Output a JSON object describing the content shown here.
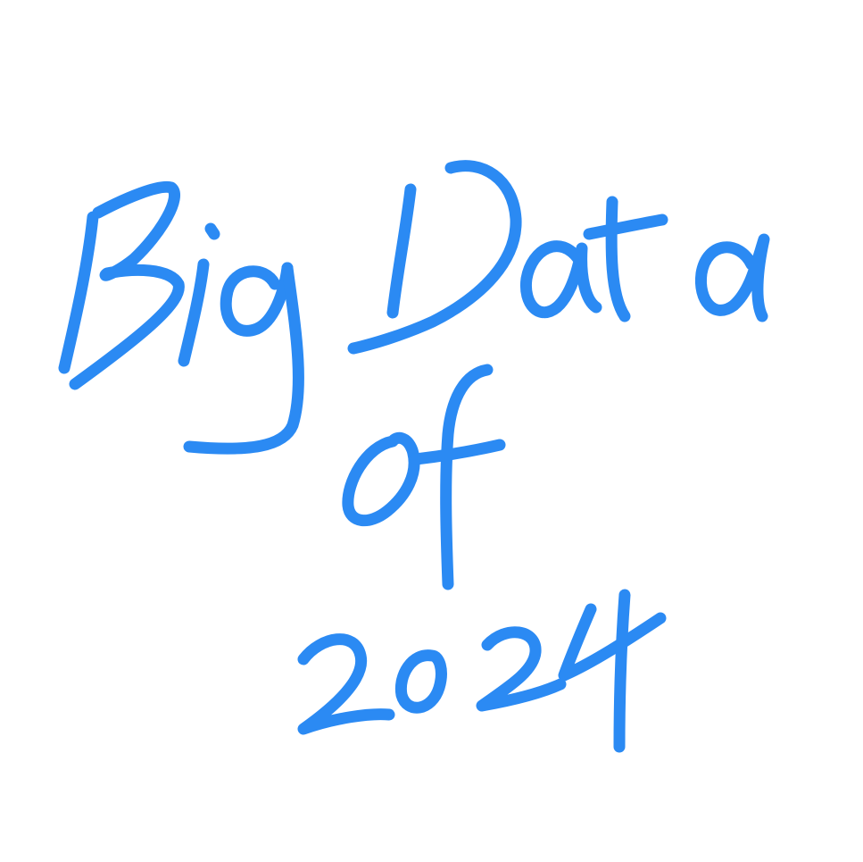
{
  "drawing": {
    "lines": [
      "Big Data",
      "of",
      "2024"
    ],
    "ink_color": "#2b8af3",
    "background_color": "#ffffff"
  }
}
